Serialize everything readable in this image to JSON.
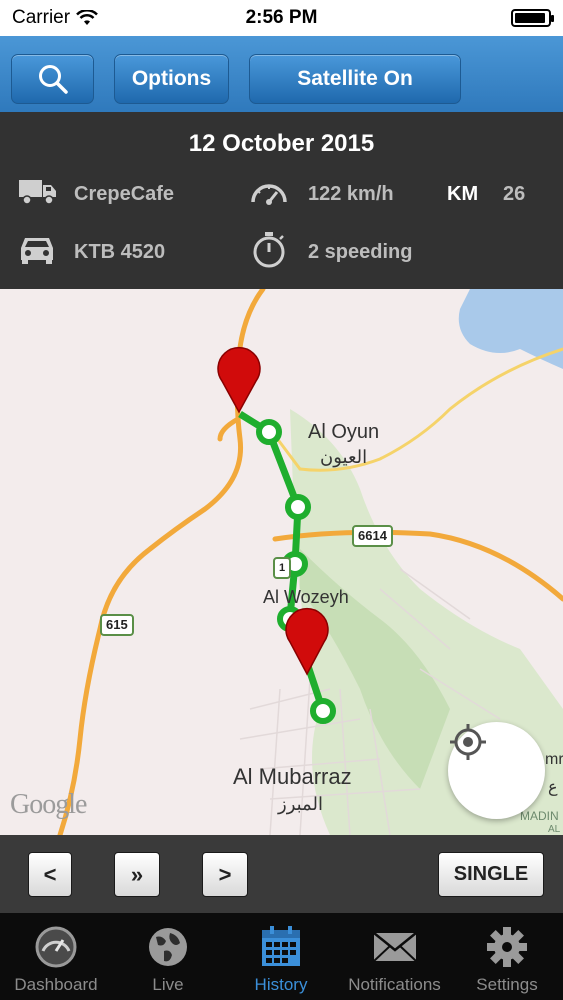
{
  "status_bar": {
    "carrier": "Carrier",
    "time": "2:56 PM",
    "battery_level": 0.95
  },
  "toolbar": {
    "search_icon": "search-icon",
    "options_label": "Options",
    "satellite_label": "Satellite On"
  },
  "info": {
    "date": "12 October 2015",
    "vehicle_name": "CrepeCafe",
    "speed": "122 km/h",
    "km_label": "KM",
    "km_value": "26",
    "plate": "KTB 4520",
    "speeding": "2 speeding",
    "icons": [
      "truck-icon",
      "speedometer-icon",
      "car-icon",
      "stopwatch-icon"
    ]
  },
  "map": {
    "labels": {
      "al_oyun": "Al Oyun",
      "al_oyun_ar": "العيون",
      "al_wozeyh": "Al Wozeyh",
      "al_mubarraz": "Al Mubarraz",
      "al_mubarraz_ar": "المبرز",
      "right_edge_1": "mr",
      "right_edge_2": "ع",
      "madin": "MADIN",
      "al": "AL"
    },
    "road_signs": {
      "sign_6614": "6614",
      "sign_615": "615",
      "sign_mid": "1"
    },
    "attribution": "Google",
    "colors": {
      "route": "#1fae2e",
      "road_major": "#f2a93b",
      "road_minor": "#f5d36a",
      "water": "#a9c9ea",
      "vegetation": "#c8e1b9",
      "pin": "#d10b0b"
    }
  },
  "playback": {
    "prev_label": "<",
    "fast_label": "»",
    "next_label": ">",
    "single_label": "SINGLE"
  },
  "tabs": [
    {
      "label": "Dashboard",
      "icon": "dashboard-icon",
      "active": false
    },
    {
      "label": "Live",
      "icon": "globe-icon",
      "active": false
    },
    {
      "label": "History",
      "icon": "calendar-icon",
      "active": true
    },
    {
      "label": "Notifications",
      "icon": "envelope-icon",
      "active": false
    },
    {
      "label": "Settings",
      "icon": "gear-icon",
      "active": false
    }
  ]
}
